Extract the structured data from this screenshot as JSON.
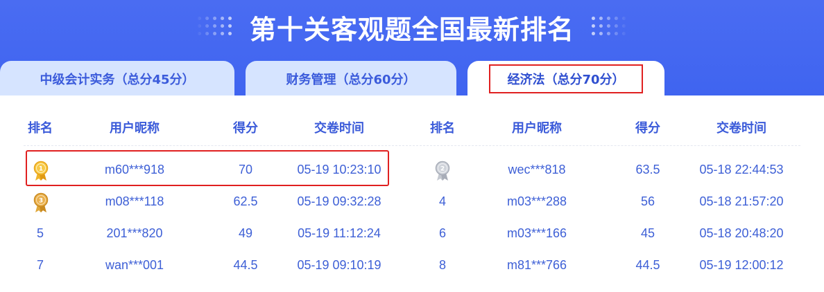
{
  "title": "第十关客观题全国最新排名",
  "tabs": [
    {
      "label": "中级会计实务（总分45分）",
      "active": false
    },
    {
      "label": "财务管理（总分60分）",
      "active": false
    },
    {
      "label": "经济法（总分70分）",
      "active": true
    }
  ],
  "headers": {
    "rank": "排名",
    "nickname": "用户昵称",
    "score": "得分",
    "time": "交卷时间"
  },
  "left_rows": [
    {
      "rank": "1",
      "medal": "gold-medal",
      "nickname": "m60***918",
      "score": "70",
      "time": "05-19 10:23:10"
    },
    {
      "rank": "3",
      "medal": "bronze-medal",
      "nickname": "m08***118",
      "score": "62.5",
      "time": "05-19 09:32:28"
    },
    {
      "rank": "5",
      "medal": null,
      "nickname": "201***820",
      "score": "49",
      "time": "05-19 11:12:24"
    },
    {
      "rank": "7",
      "medal": null,
      "nickname": "wan***001",
      "score": "44.5",
      "time": "05-19 09:10:19"
    }
  ],
  "right_rows": [
    {
      "rank": "2",
      "medal": "silver-medal",
      "nickname": "wec***818",
      "score": "63.5",
      "time": "05-18 22:44:53"
    },
    {
      "rank": "4",
      "medal": null,
      "nickname": "m03***288",
      "score": "56",
      "time": "05-18 21:57:20"
    },
    {
      "rank": "6",
      "medal": null,
      "nickname": "m03***166",
      "score": "45",
      "time": "05-18 20:48:20"
    },
    {
      "rank": "8",
      "medal": null,
      "nickname": "m81***766",
      "score": "44.5",
      "time": "05-19 12:00:12"
    }
  ],
  "colors": {
    "banner": "#4166f0",
    "tab_inactive": "#d6e4ff",
    "text_blue": "#3d5fd6",
    "highlight_red": "#e02020",
    "gold": "#f0b429",
    "silver": "#b8bcc6"
  }
}
